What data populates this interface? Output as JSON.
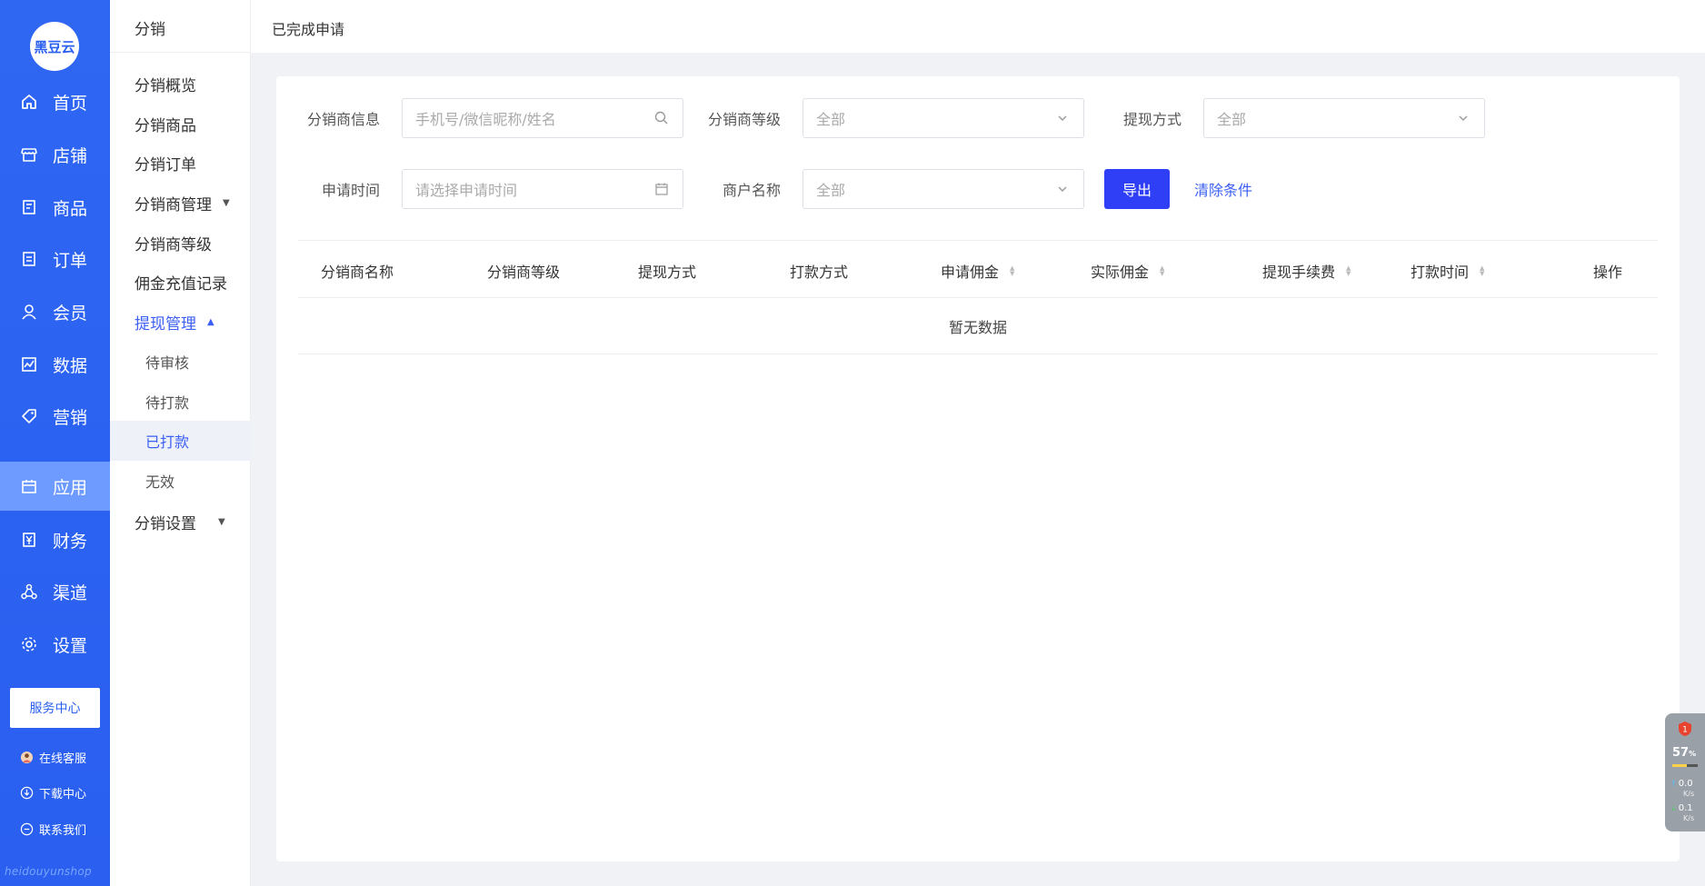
{
  "brand": {
    "logo_text": "黑豆云",
    "watermark": "heidouyunshop"
  },
  "nav1": {
    "items": [
      {
        "label": "首页",
        "icon": "home-icon"
      },
      {
        "label": "店铺",
        "icon": "store-icon"
      },
      {
        "label": "商品",
        "icon": "product-icon"
      },
      {
        "label": "订单",
        "icon": "order-icon"
      },
      {
        "label": "会员",
        "icon": "member-icon"
      },
      {
        "label": "数据",
        "icon": "data-icon"
      },
      {
        "label": "营销",
        "icon": "tag-icon"
      },
      {
        "label": "应用",
        "icon": "app-icon"
      },
      {
        "label": "财务",
        "icon": "finance-icon"
      },
      {
        "label": "渠道",
        "icon": "channel-icon"
      },
      {
        "label": "设置",
        "icon": "gear-icon"
      }
    ],
    "active_index": 7,
    "service_center": "服务中心",
    "links": [
      {
        "label": "在线客服",
        "icon": "avatar-icon"
      },
      {
        "label": "下载中心",
        "icon": "download-icon"
      },
      {
        "label": "联系我们",
        "icon": "chat-icon"
      }
    ]
  },
  "nav2": {
    "title": "分销",
    "items": {
      "overview": "分销概览",
      "products": "分销商品",
      "orders": "分销订单",
      "distributor_mgmt": "分销商管理",
      "distributor_level": "分销商等级",
      "recharge_records": "佣金充值记录",
      "withdraw_mgmt": "提现管理",
      "settings": "分销设置"
    },
    "withdraw_sub": [
      "待审核",
      "待打款",
      "已打款",
      "无效"
    ],
    "withdraw_sub_active": 2
  },
  "header": {
    "title": "已完成申请"
  },
  "filters": {
    "distributor_info_label": "分销商信息",
    "distributor_info_placeholder": "手机号/微信昵称/姓名",
    "distributor_level_label": "分销商等级",
    "distributor_level_value": "全部",
    "withdraw_method_label": "提现方式",
    "withdraw_method_value": "全部",
    "apply_time_label": "申请时间",
    "apply_time_placeholder": "请选择申请时间",
    "merchant_label": "商户名称",
    "merchant_value": "全部",
    "export_label": "导出",
    "clear_label": "清除条件"
  },
  "table": {
    "columns": [
      "分销商名称",
      "分销商等级",
      "提现方式",
      "打款方式",
      "申请佣金",
      "实际佣金",
      "提现手续费",
      "打款时间",
      "操作"
    ],
    "empty_text": "暂无数据"
  },
  "widget": {
    "badge": "1",
    "percent": "57",
    "percent_unit": "%",
    "percent_value": 57,
    "up": "0.0",
    "down": "0.1",
    "unit": "K/s"
  },
  "colors": {
    "primary": "#2a5ff0",
    "active_nav": "#6e9bff",
    "button": "#2f3ff5",
    "link": "#3c5ff5"
  }
}
